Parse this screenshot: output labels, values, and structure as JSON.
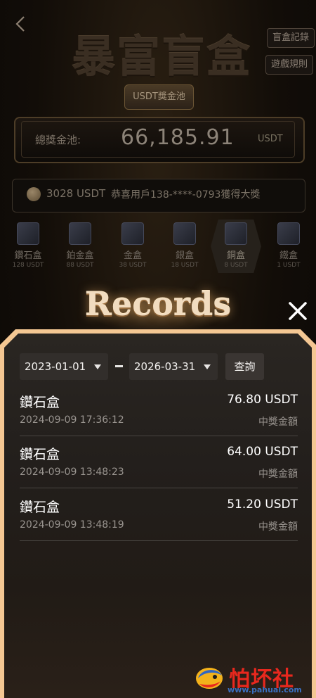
{
  "background": {
    "back_icon": "chevron-left-icon",
    "title": "暴富盲盒",
    "records_link": "盲盒記錄",
    "rules_link": "遊戲規則",
    "pool_tag": "USDT獎金池",
    "pool_label": "總獎金池:",
    "pool_value": "66,185.91",
    "pool_unit": "USDT",
    "ticker_amount": "3028 USDT",
    "ticker_text": "恭喜用戶138-****-0793獲得大獎",
    "boxes": [
      {
        "name": "鑽石盒",
        "price": "128 USDT"
      },
      {
        "name": "鉑金盒",
        "price": "88 USDT"
      },
      {
        "name": "金盒",
        "price": "38 USDT"
      },
      {
        "name": "銀盒",
        "price": "18 USDT"
      },
      {
        "name": "銅盒",
        "price": "8 USDT"
      },
      {
        "name": "鐵盒",
        "price": "1 USDT"
      }
    ]
  },
  "modal": {
    "title": "Records",
    "close_icon": "close-icon",
    "filter": {
      "start_date": "2023-01-01",
      "end_date": "2026-03-31",
      "separator": "-",
      "query_label": "查詢"
    },
    "records": [
      {
        "name": "鑽石盒",
        "amount": "76.80 USDT",
        "time": "2024-09-09 17:36:12",
        "label": "中獎金額"
      },
      {
        "name": "鑽石盒",
        "amount": "64.00 USDT",
        "time": "2024-09-09 13:48:23",
        "label": "中獎金額"
      },
      {
        "name": "鑽石盒",
        "amount": "51.20 USDT",
        "time": "2024-09-09 13:48:19",
        "label": "中獎金額"
      }
    ]
  },
  "watermark": {
    "text": "怕坏社区",
    "url": "www.pahuai.com"
  }
}
